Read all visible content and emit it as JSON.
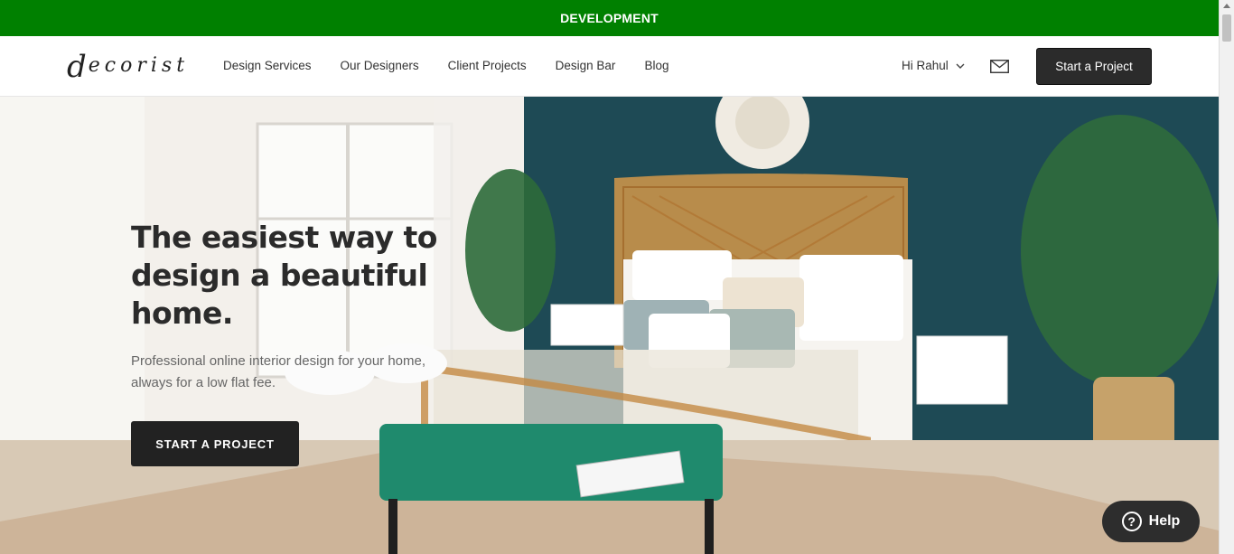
{
  "env_banner": {
    "label": "DEVELOPMENT",
    "color": "#008000"
  },
  "header": {
    "logo_text": "ecorist",
    "logo_initial": "d",
    "nav": [
      {
        "label": "Design Services"
      },
      {
        "label": "Our Designers"
      },
      {
        "label": "Client Projects"
      },
      {
        "label": "Design Bar"
      },
      {
        "label": "Blog"
      }
    ],
    "user_greeting": "Hi Rahul",
    "user_icon": "chevron-down-icon",
    "mail_icon": "envelope-icon",
    "cta_label": "Start a Project"
  },
  "hero": {
    "headline": "The easiest way to design a beautiful home.",
    "subheadline": "Professional online interior design for your home, always for a low flat fee.",
    "cta_label": "START A PROJECT"
  },
  "help_widget": {
    "label": "Help",
    "icon": "question-circle-icon"
  },
  "colors": {
    "dark_button": "#222222",
    "wall_teal": "#1e4a55"
  }
}
